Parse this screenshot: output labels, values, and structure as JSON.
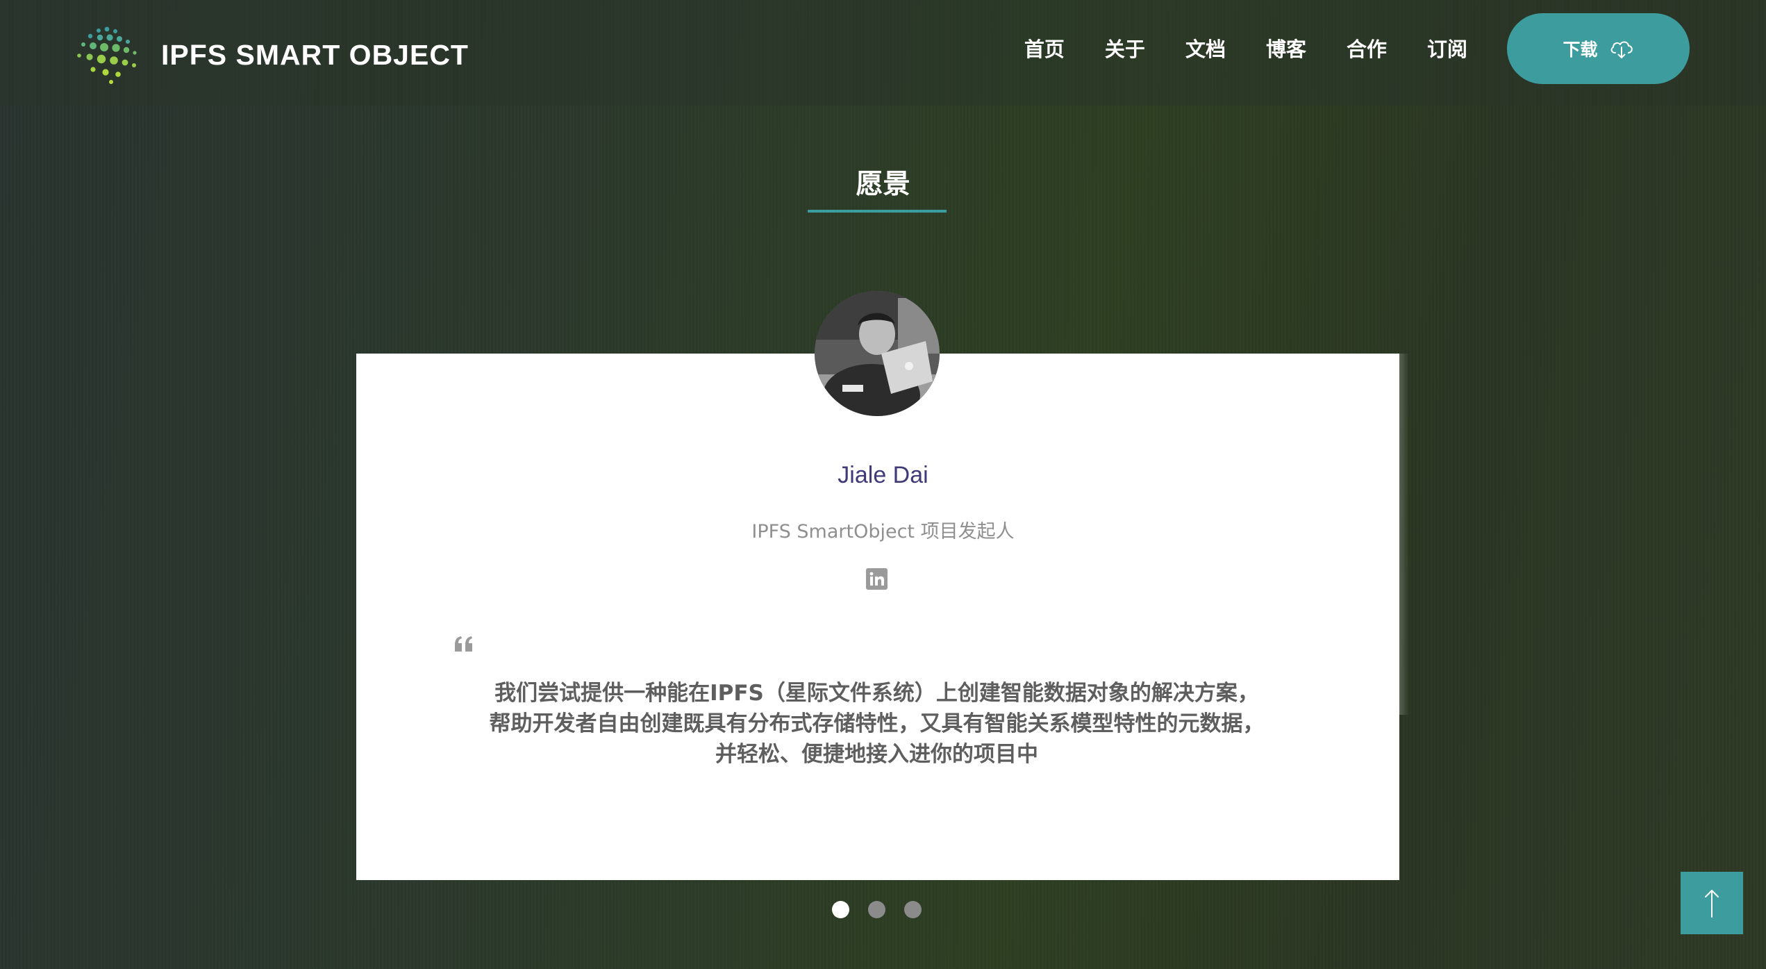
{
  "brand": {
    "name": "IPFS SMART OBJECT",
    "logo_icon": "dotted-globe-logo"
  },
  "nav": {
    "items": [
      {
        "label": "首页"
      },
      {
        "label": "关于"
      },
      {
        "label": "文档"
      },
      {
        "label": "博客"
      },
      {
        "label": "合作"
      },
      {
        "label": "订阅"
      }
    ],
    "download_label": "下载",
    "download_icon": "cloud-download-icon"
  },
  "section": {
    "title": "愿景"
  },
  "testimonial": {
    "name": "Jiale Dai",
    "role": "IPFS SmartObject 项目发起人",
    "social_icon": "linkedin-icon",
    "quote_icon": "quote-icon",
    "quote_lines": [
      "我们尝试提供一种能在IPFS（星际文件系统）上创建智能数据对象的解决方案，",
      "帮助开发者自由创建既具有分布式存储特性，又具有智能关系模型特性的元数据，",
      "并轻松、便捷地接入进你的项目中"
    ]
  },
  "pager": {
    "total": 3,
    "active_index": 0
  },
  "colors": {
    "accent": "#3d9c9d",
    "name_color": "#3f3a78",
    "role_color": "#8f8f8f",
    "quote_color": "#5e5e5e"
  },
  "back_to_top_icon": "arrow-up-icon"
}
